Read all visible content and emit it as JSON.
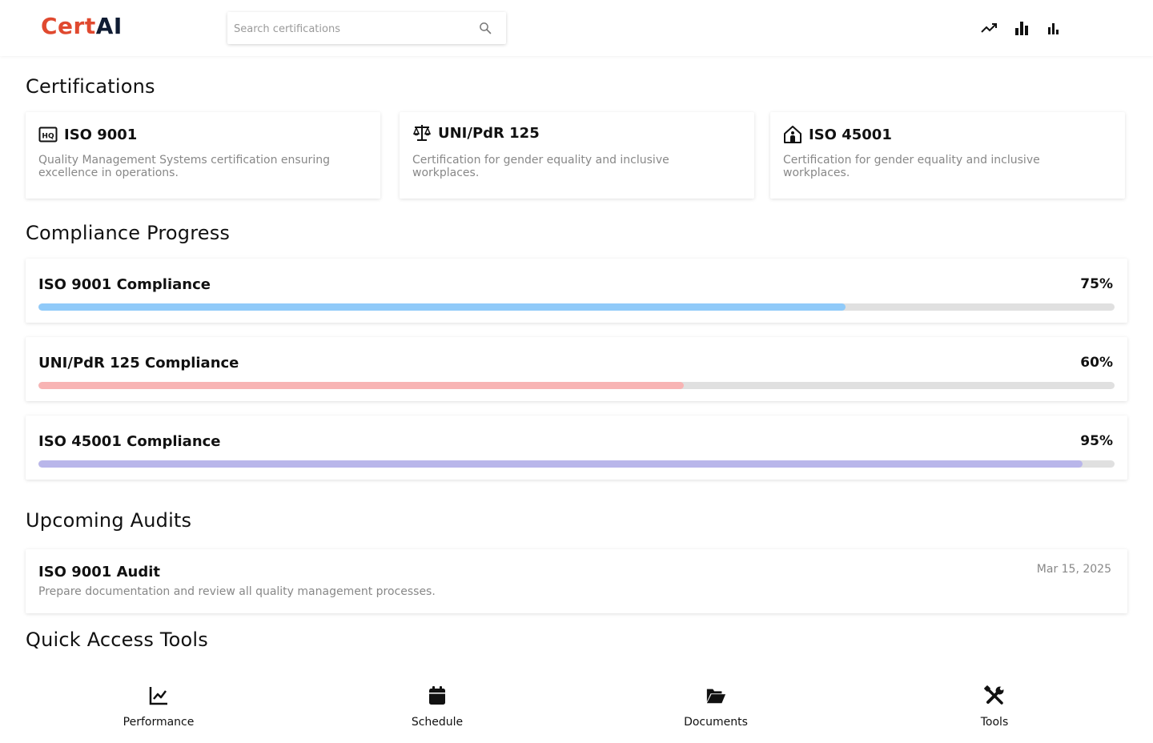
{
  "header": {
    "logo_part1": "Cert",
    "logo_part2": "AI",
    "search_placeholder": "Search certifications",
    "icons": [
      "trending-up-icon",
      "bar-chart-icon",
      "bar-chart-small-icon"
    ]
  },
  "sections": {
    "certifications": "Certifications",
    "compliance": "Compliance Progress",
    "audits": "Upcoming Audits",
    "tools": "Quick Access Tools"
  },
  "certifications": [
    {
      "icon": "hq-icon",
      "title": "ISO 9001",
      "description": "Quality Management Systems certification ensuring excellence in operations."
    },
    {
      "icon": "scale-icon",
      "title": "UNI/PdR 125",
      "description": "Certification for gender equality and inclusive workplaces."
    },
    {
      "icon": "house-person-icon",
      "title": "ISO 45001",
      "description": "Certification for gender equality and inclusive workplaces."
    }
  ],
  "compliance": [
    {
      "title": "ISO 9001 Compliance",
      "percent_label": "75%",
      "value": 0.75,
      "color": "#90caf9"
    },
    {
      "title": "UNI/PdR 125 Compliance",
      "percent_label": "60%",
      "value": 0.6,
      "color": "#f8b4b4"
    },
    {
      "title": "ISO 45001 Compliance",
      "percent_label": "95%",
      "value": 0.97,
      "color": "#b9b6ea"
    }
  ],
  "audits": [
    {
      "title": "ISO 9001 Audit",
      "date": "Mar 15, 2025",
      "description": "Prepare documentation and review all quality management processes."
    }
  ],
  "tools": [
    {
      "icon": "line-chart-icon",
      "label": "Performance"
    },
    {
      "icon": "calendar-icon",
      "label": "Schedule"
    },
    {
      "icon": "folder-open-icon",
      "label": "Documents"
    },
    {
      "icon": "wrench-screwdriver-icon",
      "label": "Tools"
    }
  ],
  "colors": {
    "brand_red": "#e0492f",
    "brand_navy": "#101c33",
    "muted_text": "#888888",
    "track": "#e0e0e0"
  }
}
